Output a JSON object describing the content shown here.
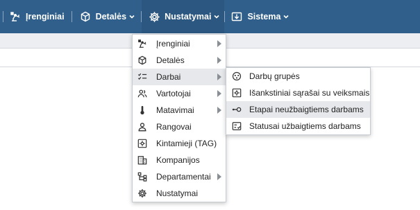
{
  "topnav": {
    "items": [
      {
        "label": "Įrenginiai",
        "icon": "robot-arm-icon"
      },
      {
        "label": "Detalės",
        "icon": "cube-icon"
      },
      {
        "label": "Nustatymai",
        "icon": "gear-icon"
      },
      {
        "label": "Sistema",
        "icon": "download-box-icon"
      }
    ]
  },
  "settings_menu": {
    "items": [
      {
        "label": "Įrenginiai",
        "icon": "robot-arm-icon",
        "submenu": true
      },
      {
        "label": "Detalės",
        "icon": "cube-icon",
        "submenu": true
      },
      {
        "label": "Darbai",
        "icon": "checklist-icon",
        "submenu": true,
        "highlighted": true
      },
      {
        "label": "Vartotojai",
        "icon": "users-icon",
        "submenu": true
      },
      {
        "label": "Matavimai",
        "icon": "thermometer-icon",
        "submenu": true
      },
      {
        "label": "Rangovai",
        "icon": "person-icon",
        "submenu": false
      },
      {
        "label": "Kintamieji (TAG)",
        "icon": "tag-gear-icon",
        "submenu": false
      },
      {
        "label": "Kompanijos",
        "icon": "building-icon",
        "submenu": false
      },
      {
        "label": "Departamentai",
        "icon": "hierarchy-icon",
        "submenu": true
      },
      {
        "label": "Nustatymai",
        "icon": "gear-icon",
        "submenu": false
      }
    ]
  },
  "jobs_submenu": {
    "items": [
      {
        "label": "Darbų grupės",
        "icon": "group-circle-icon"
      },
      {
        "label": "Išankstiniai sąrašai su veiksmais",
        "icon": "settings-box-icon"
      },
      {
        "label": "Etapai neužbaigtiems darbams",
        "icon": "stage-key-icon",
        "highlighted": true
      },
      {
        "label": "Statusai užbaigtiems darbams",
        "icon": "status-list-icon"
      }
    ]
  },
  "colors": {
    "topbar": "#2f5f8a",
    "highlight": "#e6e8eb"
  }
}
